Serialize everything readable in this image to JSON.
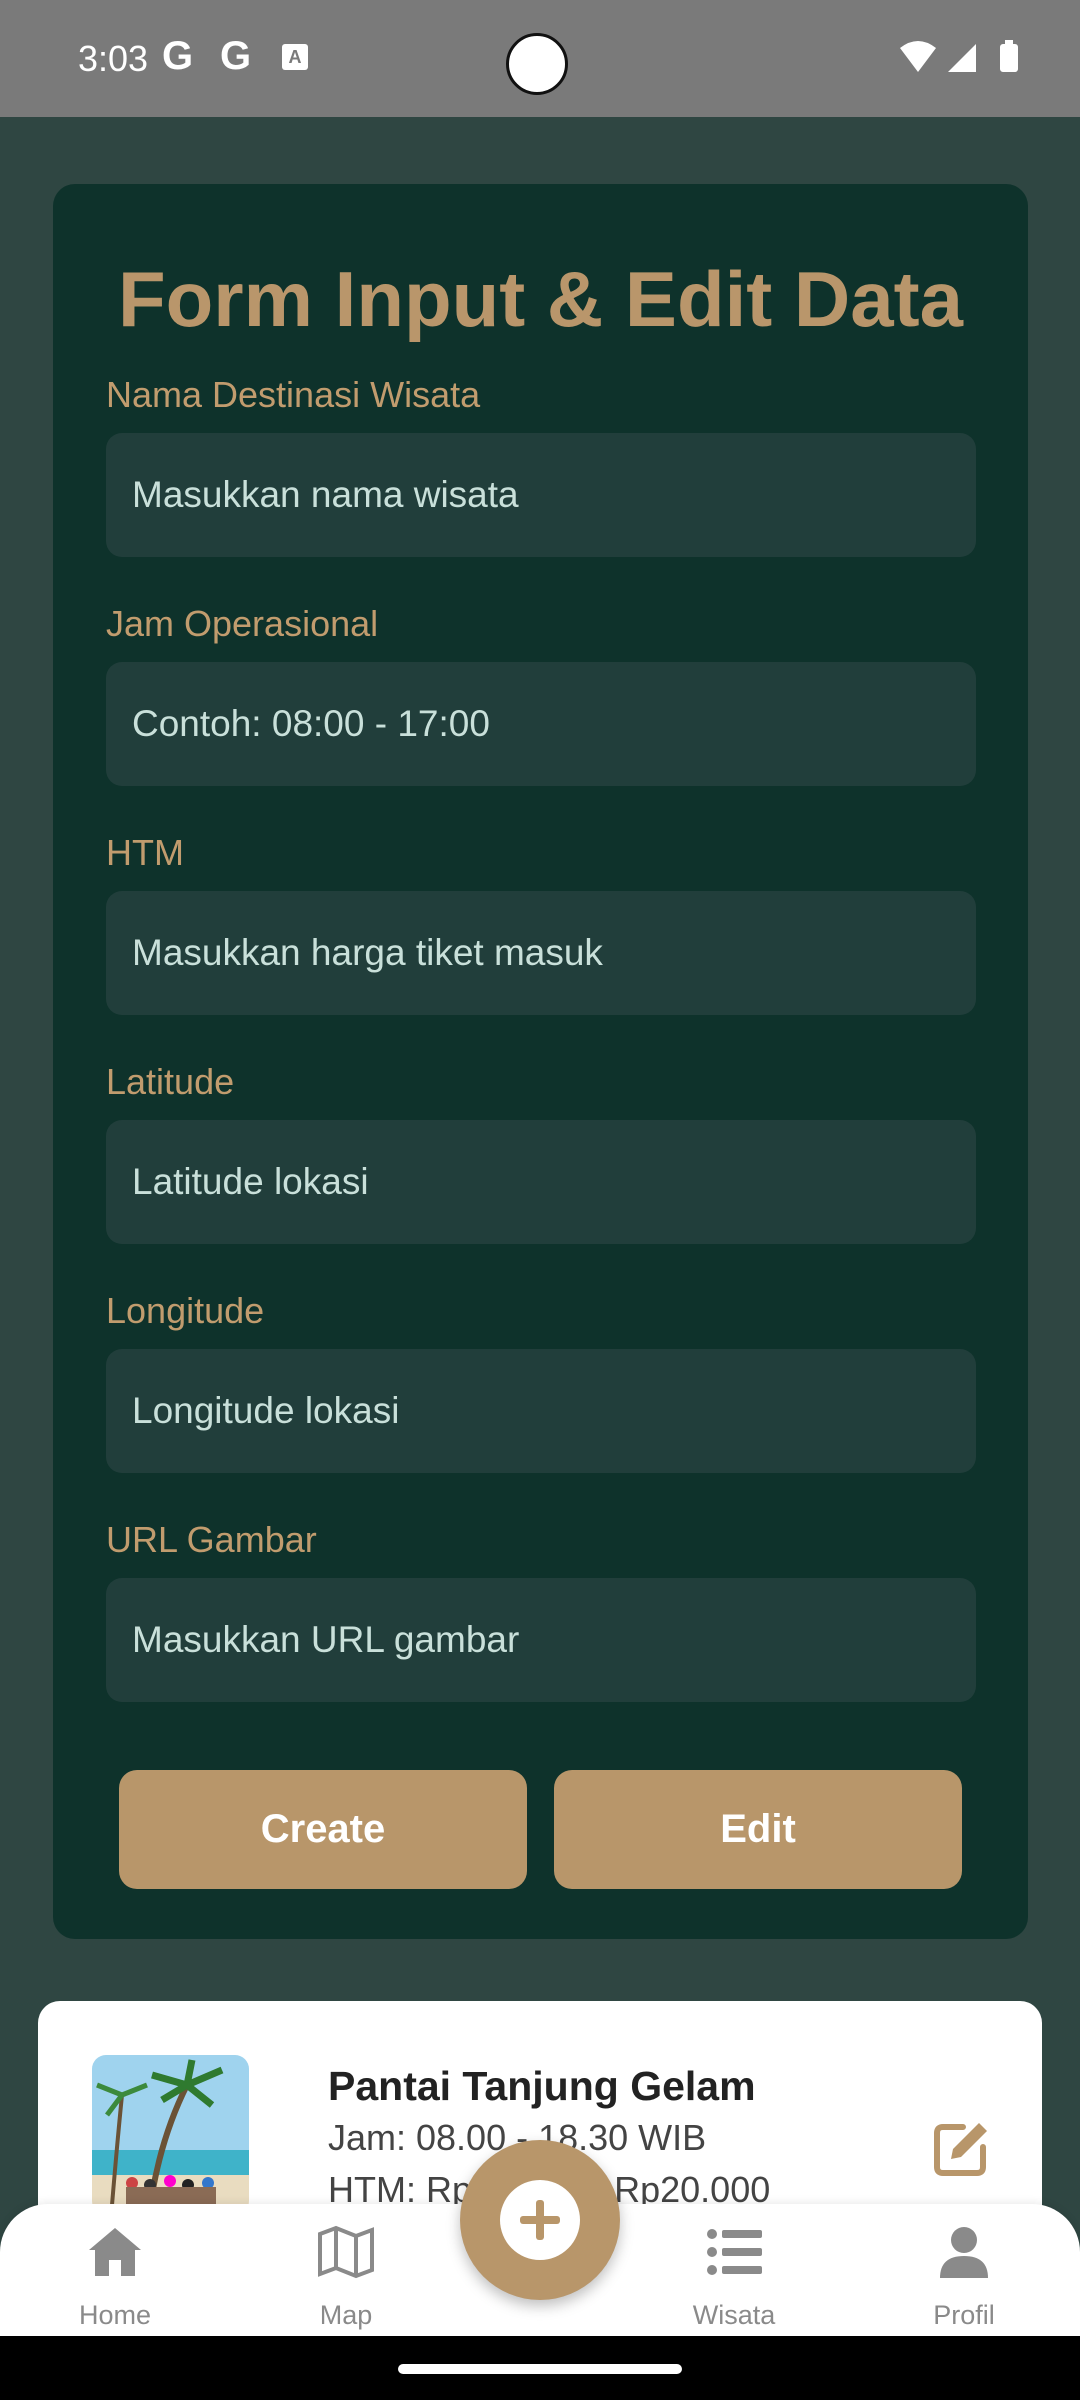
{
  "status_bar": {
    "time": "3:03",
    "g1": "G",
    "g2": "G",
    "a": "A"
  },
  "form": {
    "title": "Form Input & Edit Data",
    "fields": [
      {
        "label": "Nama Destinasi Wisata",
        "placeholder": "Masukkan nama wisata"
      },
      {
        "label": "Jam Operasional",
        "placeholder": "Contoh: 08:00 - 17:00"
      },
      {
        "label": "HTM",
        "placeholder": "Masukkan harga tiket masuk"
      },
      {
        "label": "Latitude",
        "placeholder": "Latitude lokasi"
      },
      {
        "label": "Longitude",
        "placeholder": "Longitude lokasi"
      },
      {
        "label": "URL Gambar",
        "placeholder": "Masukkan URL gambar"
      }
    ],
    "create_label": "Create",
    "edit_label": "Edit"
  },
  "item": {
    "name": "Pantai Tanjung Gelam",
    "jam": "Jam: 08.00 - 18.30 WIB",
    "htm": "HTM: Rp10.000 - Rp20.000"
  },
  "nav": {
    "home": "Home",
    "map": "Map",
    "wisata": "Wisata",
    "profil": "Profil"
  },
  "colors": {
    "accent": "#b8966a",
    "card": "#0e322b",
    "background": "#2f4642",
    "input": "#213e3b"
  }
}
